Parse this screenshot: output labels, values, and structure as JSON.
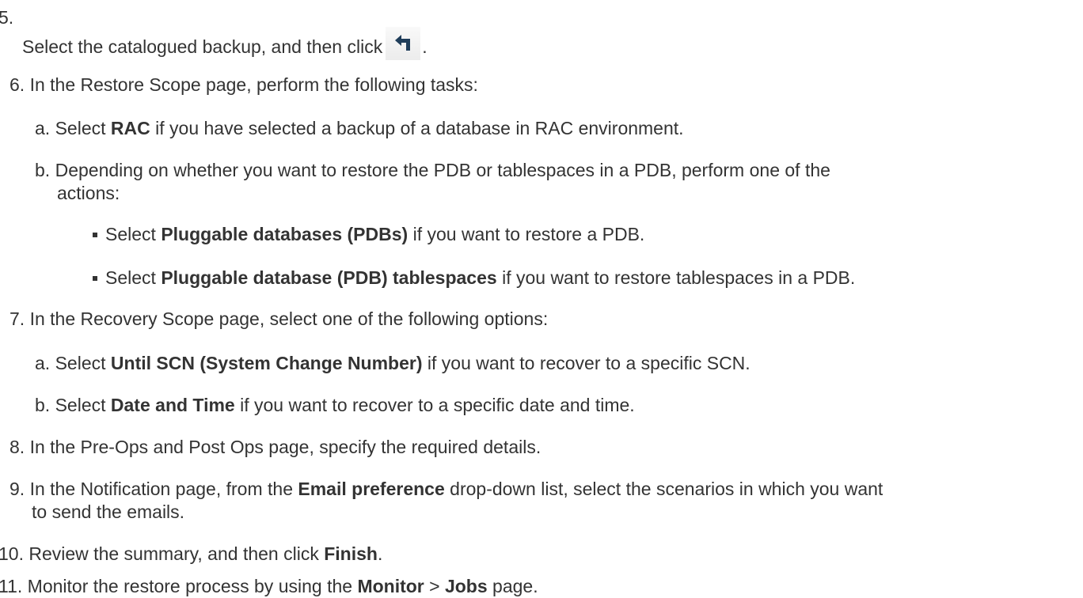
{
  "step5": {
    "number": "5.",
    "text": "Select the catalogued backup, and then click",
    "after": ".",
    "icon": "restore-arrow-icon"
  },
  "step6": {
    "number": "6.",
    "text": "In the Restore Scope page, perform the following tasks:",
    "a": {
      "marker": "a.",
      "pre": "Select",
      "bold": "RAC",
      "post": "if you have selected a backup of a database in RAC environment."
    },
    "b": {
      "marker": "b.",
      "line1": "Depending on whether you want to restore the PDB or tablespaces in a PDB, perform one of the",
      "line2": "actions:",
      "bullets": [
        {
          "pre": "Select",
          "bold": "Pluggable databases (PDBs)",
          "post": "if you want to restore a PDB."
        },
        {
          "pre": "Select",
          "bold": "Pluggable database (PDB) tablespaces",
          "post": "if you want to restore tablespaces in a PDB."
        }
      ]
    }
  },
  "step7": {
    "number": "7.",
    "text": "In the Recovery Scope page, select one of the following options:",
    "a": {
      "marker": "a.",
      "pre": "Select",
      "bold": "Until SCN (System Change Number)",
      "post": "if you want to recover to a specific SCN."
    },
    "b": {
      "marker": "b.",
      "pre": "Select",
      "bold": "Date and Time",
      "post": "if you want to recover to a specific date and time."
    }
  },
  "step8": {
    "number": "8.",
    "text": "In the Pre-Ops and Post Ops page, specify the required details."
  },
  "step9": {
    "number": "9.",
    "pre": "In the Notification page, from the",
    "bold": "Email preference",
    "post": "drop-down list, select the scenarios in which you want",
    "line2": "to send the emails."
  },
  "step10": {
    "number": "10.",
    "pre": "Review the summary, and then click",
    "bold": "Finish",
    "post": "."
  },
  "step11": {
    "number": "11.",
    "pre": "Monitor the restore process by using the",
    "bold1": "Monitor",
    "sep": ">",
    "bold2": "Jobs",
    "post": "page."
  }
}
